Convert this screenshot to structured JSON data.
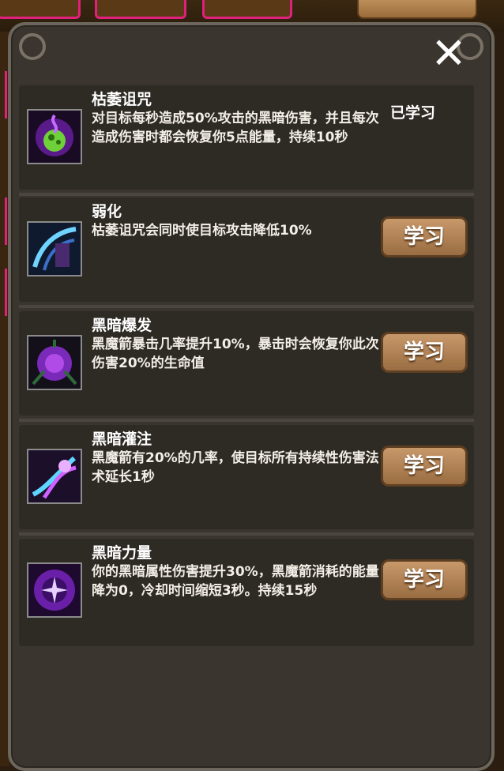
{
  "close_label": "✕",
  "skills": [
    {
      "title": "枯萎诅咒",
      "desc": "对目标每秒造成50%攻击的黑暗伤害，并且每次造成伤害时都会恢复你5点能量，持续10秒",
      "status": "已学习"
    },
    {
      "title": "弱化",
      "desc": "枯萎诅咒会同时使目标攻击降低10%",
      "button": "学习"
    },
    {
      "title": "黑暗爆发",
      "desc": "黑魔箭暴击几率提升10%，暴击时会恢复你此次伤害20%的生命值",
      "button": "学习"
    },
    {
      "title": "黑暗灌注",
      "desc": "黑魔箭有20%的几率，使目标所有持续性伤害法术延长1秒",
      "button": "学习"
    },
    {
      "title": "黑暗力量",
      "desc": "你的黑暗属性伤害提升30%，黑魔箭消耗的能量降为0，冷却时间缩短3秒。持续15秒",
      "button": "学习"
    }
  ],
  "icons": [
    "withering-curse-icon",
    "weaken-icon",
    "dark-burst-icon",
    "dark-infusion-icon",
    "dark-power-icon"
  ]
}
